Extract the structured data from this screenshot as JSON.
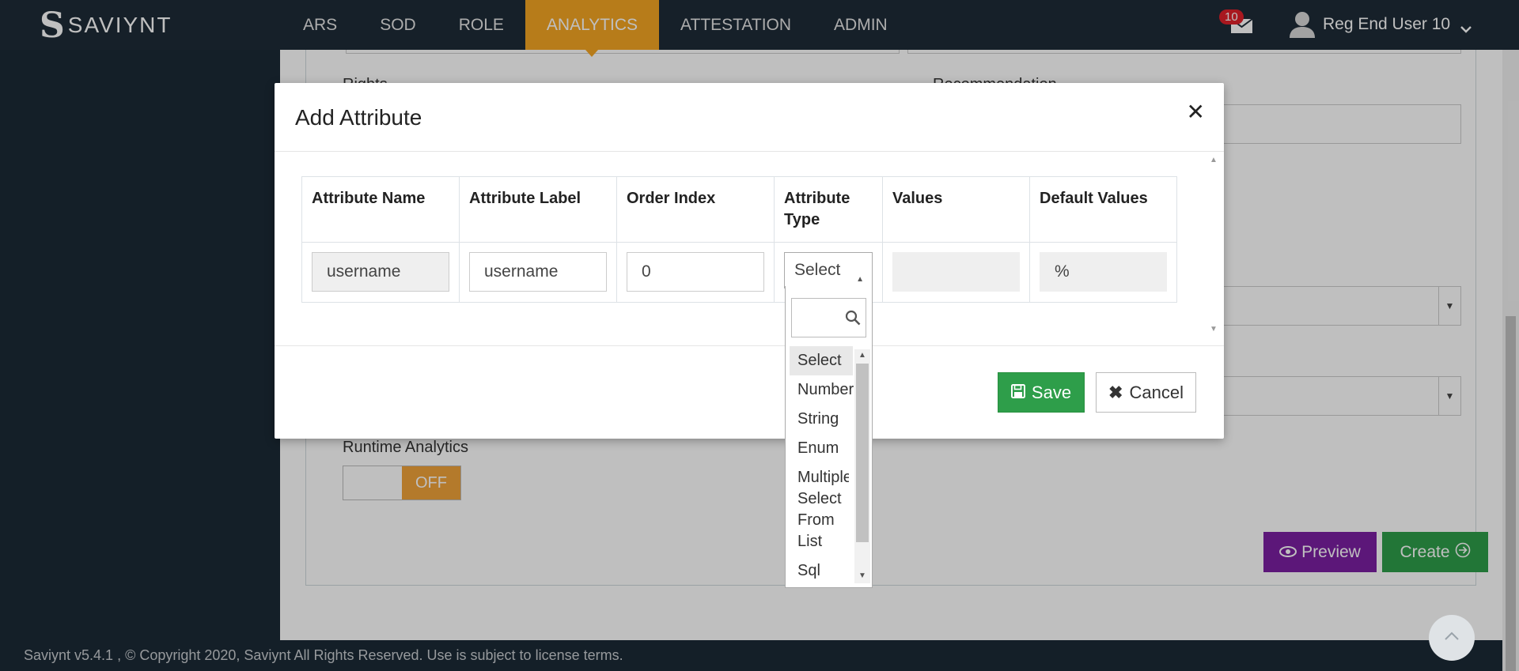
{
  "app": {
    "logo_text": "SAVIYNT",
    "nav": [
      "ARS",
      "SOD",
      "ROLE",
      "ANALYTICS",
      "ATTESTATION",
      "ADMIN"
    ],
    "active_nav": "ANALYTICS",
    "notifications_count": "10",
    "user_name": "Reg End User 10"
  },
  "background": {
    "label_rights": "Rights",
    "label_recommendation": "Recommendation",
    "runtime_label": "Runtime Analytics",
    "toggle_state": "OFF",
    "preview_label": "Preview",
    "create_label": "Create"
  },
  "modal": {
    "title": "Add Attribute",
    "columns": [
      "Attribute Name",
      "Attribute Label",
      "Order Index",
      "Attribute Type",
      "Values",
      "Default Values"
    ],
    "row": {
      "attribute_name": "username",
      "attribute_label": "username",
      "order_index": "0",
      "attribute_type": "Select",
      "values": "",
      "default_values": "%"
    },
    "save_label": "Save",
    "cancel_label": "Cancel"
  },
  "dropdown": {
    "search_placeholder": "",
    "options": [
      "Select",
      "Number",
      "String",
      "Enum",
      "Multiple Select From List",
      "Sql"
    ],
    "highlighted": "Select"
  },
  "footer": {
    "text": "Saviynt v5.4.1 , © Copyright  2020, Saviynt All Rights Reserved. Use is subject to license terms."
  },
  "colors": {
    "accent": "#f5a623",
    "save_green": "#2e9e4a",
    "preview_purple": "#7b1fa2",
    "badge_red": "#e0202a",
    "nav_bg": "#1e2b37"
  }
}
